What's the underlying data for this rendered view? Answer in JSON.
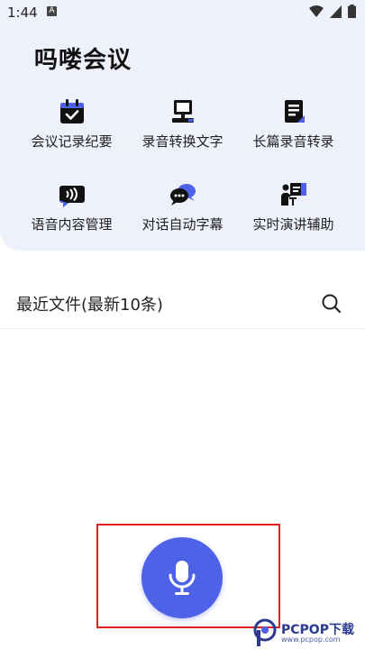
{
  "status_bar": {
    "time": "1:44",
    "badge": "A"
  },
  "app": {
    "title": "吗喽会议"
  },
  "features": [
    {
      "label": "会议记录纪要",
      "icon": "calendar-check-icon"
    },
    {
      "label": "录音转换文字",
      "icon": "computer-monitor-icon"
    },
    {
      "label": "长篇录音转录",
      "icon": "document-list-icon"
    },
    {
      "label": "语音内容管理",
      "icon": "voice-bubble-icon"
    },
    {
      "label": "对话自动字幕",
      "icon": "chat-bubbles-icon"
    },
    {
      "label": "实时演讲辅助",
      "icon": "presenter-icon"
    }
  ],
  "recent": {
    "title": "最近文件(最新10条)"
  },
  "colors": {
    "accent": "#4e62e8",
    "header_bg": "#eef0fb",
    "frame": "#e02020"
  },
  "watermark": {
    "brand": "PCPOP下载",
    "url": "www.pcpop.com"
  }
}
